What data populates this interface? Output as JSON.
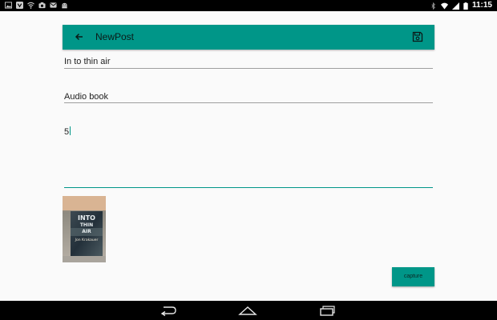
{
  "status_bar": {
    "time": "11:15",
    "icons_left": [
      "gallery-icon",
      "shield-icon",
      "wifi-icon",
      "camera-icon",
      "mail-icon",
      "android-icon"
    ],
    "icons_right": [
      "bluetooth-icon",
      "wifi-icon",
      "signal-icon",
      "battery-icon"
    ]
  },
  "toolbar": {
    "title": "NewPost",
    "back_icon": "arrow-back-icon",
    "save_icon": "save-icon",
    "color": "#009688"
  },
  "form": {
    "title_value": "In to thin air",
    "category_value": "Audio book",
    "description_value": "5"
  },
  "thumbnail": {
    "text": [
      "INTO",
      "THIN",
      "AIR",
      "Jon Krakauer"
    ]
  },
  "capture_button": {
    "label": "capture"
  },
  "nav_bar": {
    "icons": [
      "back-icon",
      "home-icon",
      "recents-icon"
    ]
  }
}
